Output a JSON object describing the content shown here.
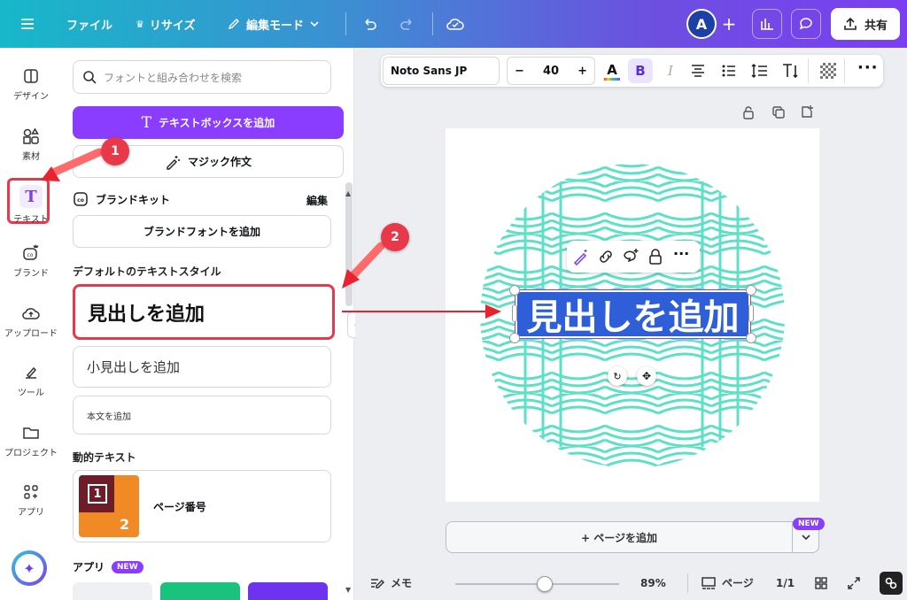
{
  "topbar": {
    "file": "ファイル",
    "resize": "リサイズ",
    "edit_mode": "編集モード",
    "avatar": "A",
    "share": "共有"
  },
  "rail": [
    "デザイン",
    "素材",
    "テキスト",
    "ブランド",
    "アップロード",
    "ツール",
    "プロジェクト",
    "アプリ"
  ],
  "panel": {
    "search_placeholder": "フォントと組み合わせを検索",
    "add_textbox": "テキストボックスを追加",
    "magic_write": "マジック作文",
    "brand_kit": "ブランドキット",
    "edit": "編集",
    "add_brand_font": "ブランドフォントを追加",
    "default_styles": "デフォルトのテキストスタイル",
    "heading": "見出しを追加",
    "subheading": "小見出しを追加",
    "body": "本文を追加",
    "dynamic_text": "動的テキスト",
    "page_number": "ページ番号",
    "page_thumb_1": "1",
    "page_thumb_2": "2",
    "apps": "アプリ",
    "new": "NEW"
  },
  "annotations": {
    "step1": "1",
    "step2": "2"
  },
  "format": {
    "font": "Noto Sans JP",
    "size": "40",
    "minus": "−",
    "plus": "+",
    "bold": "B",
    "italic": "I"
  },
  "canvas": {
    "heading_text": "見出しを追加",
    "add_page": "+ ページを追加",
    "new": "NEW"
  },
  "bottom": {
    "memo": "メモ",
    "zoom": "89%",
    "page_label": "ページ",
    "page_count": "1/1"
  },
  "colors": {
    "accent": "#8b3dff",
    "highlight": "#e8394b",
    "selection": "#2e5fd9",
    "pattern": "#5ce1c7"
  }
}
